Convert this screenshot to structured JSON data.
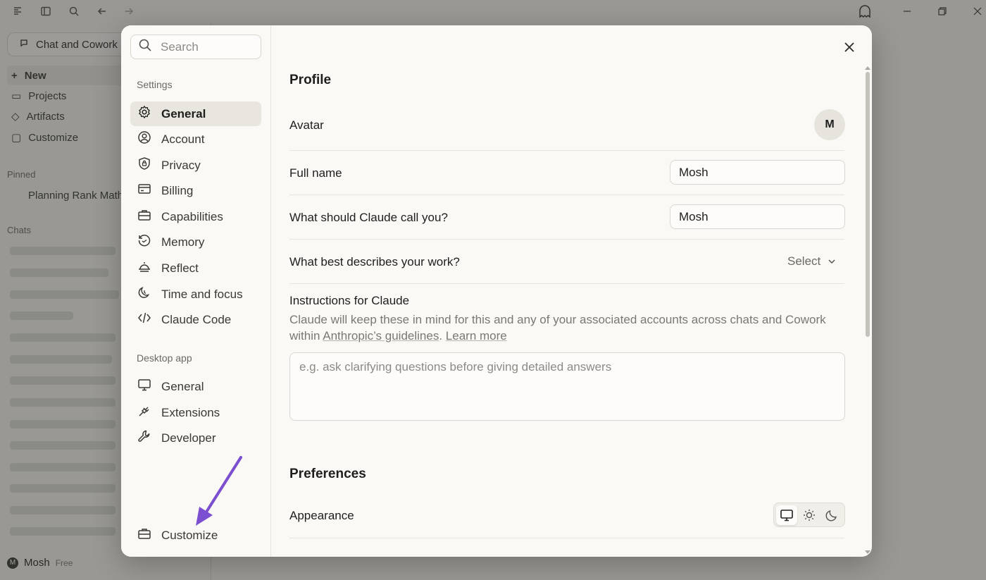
{
  "background": {
    "sidebar_toggle_label": "Chat and Cowork",
    "nav": [
      "New",
      "Projects",
      "Artifacts",
      "Customize"
    ],
    "pinned_label": "Pinned",
    "pinned_item": "Planning Rank Math",
    "chats_label": "Chats",
    "user_name": "Mosh",
    "user_plan": "Free",
    "user_initial": "M"
  },
  "settings": {
    "search_placeholder": "Search",
    "section_settings": "Settings",
    "items": [
      {
        "label": "General",
        "icon": "gear-icon",
        "active": true
      },
      {
        "label": "Account",
        "icon": "user-circle-icon"
      },
      {
        "label": "Privacy",
        "icon": "shield-icon"
      },
      {
        "label": "Billing",
        "icon": "credit-card-icon"
      },
      {
        "label": "Capabilities",
        "icon": "briefcase-icon"
      },
      {
        "label": "Memory",
        "icon": "history-icon"
      },
      {
        "label": "Reflect",
        "icon": "sunrise-icon"
      },
      {
        "label": "Time and focus",
        "icon": "moon-icon"
      },
      {
        "label": "Claude Code",
        "icon": "code-icon"
      }
    ],
    "section_desktop": "Desktop app",
    "desktop_items": [
      {
        "label": "General",
        "icon": "monitor-icon"
      },
      {
        "label": "Extensions",
        "icon": "plug-icon"
      },
      {
        "label": "Developer",
        "icon": "wrench-icon"
      }
    ],
    "bottom_item": {
      "label": "Customize",
      "icon": "briefcase-icon"
    }
  },
  "profile": {
    "heading": "Profile",
    "avatar_label": "Avatar",
    "avatar_initial": "M",
    "full_name_label": "Full name",
    "full_name_value": "Mosh",
    "call_label": "What should Claude call you?",
    "call_value": "Mosh",
    "work_label": "What best describes your work?",
    "work_select": "Select",
    "instructions_title": "Instructions for Claude",
    "instructions_desc": "Claude will keep these in mind for this and any of your associated accounts across chats and Cowork within",
    "guidelines_link": "Anthropic’s guidelines",
    "learn_more": "Learn more",
    "instructions_placeholder": "e.g. ask clarifying questions before giving detailed answers"
  },
  "preferences": {
    "heading": "Preferences",
    "appearance_label": "Appearance",
    "appearance_options": [
      "system",
      "light",
      "dark"
    ],
    "appearance_selected": "system"
  },
  "annotation": {
    "arrow_color": "#7b4fcf"
  }
}
